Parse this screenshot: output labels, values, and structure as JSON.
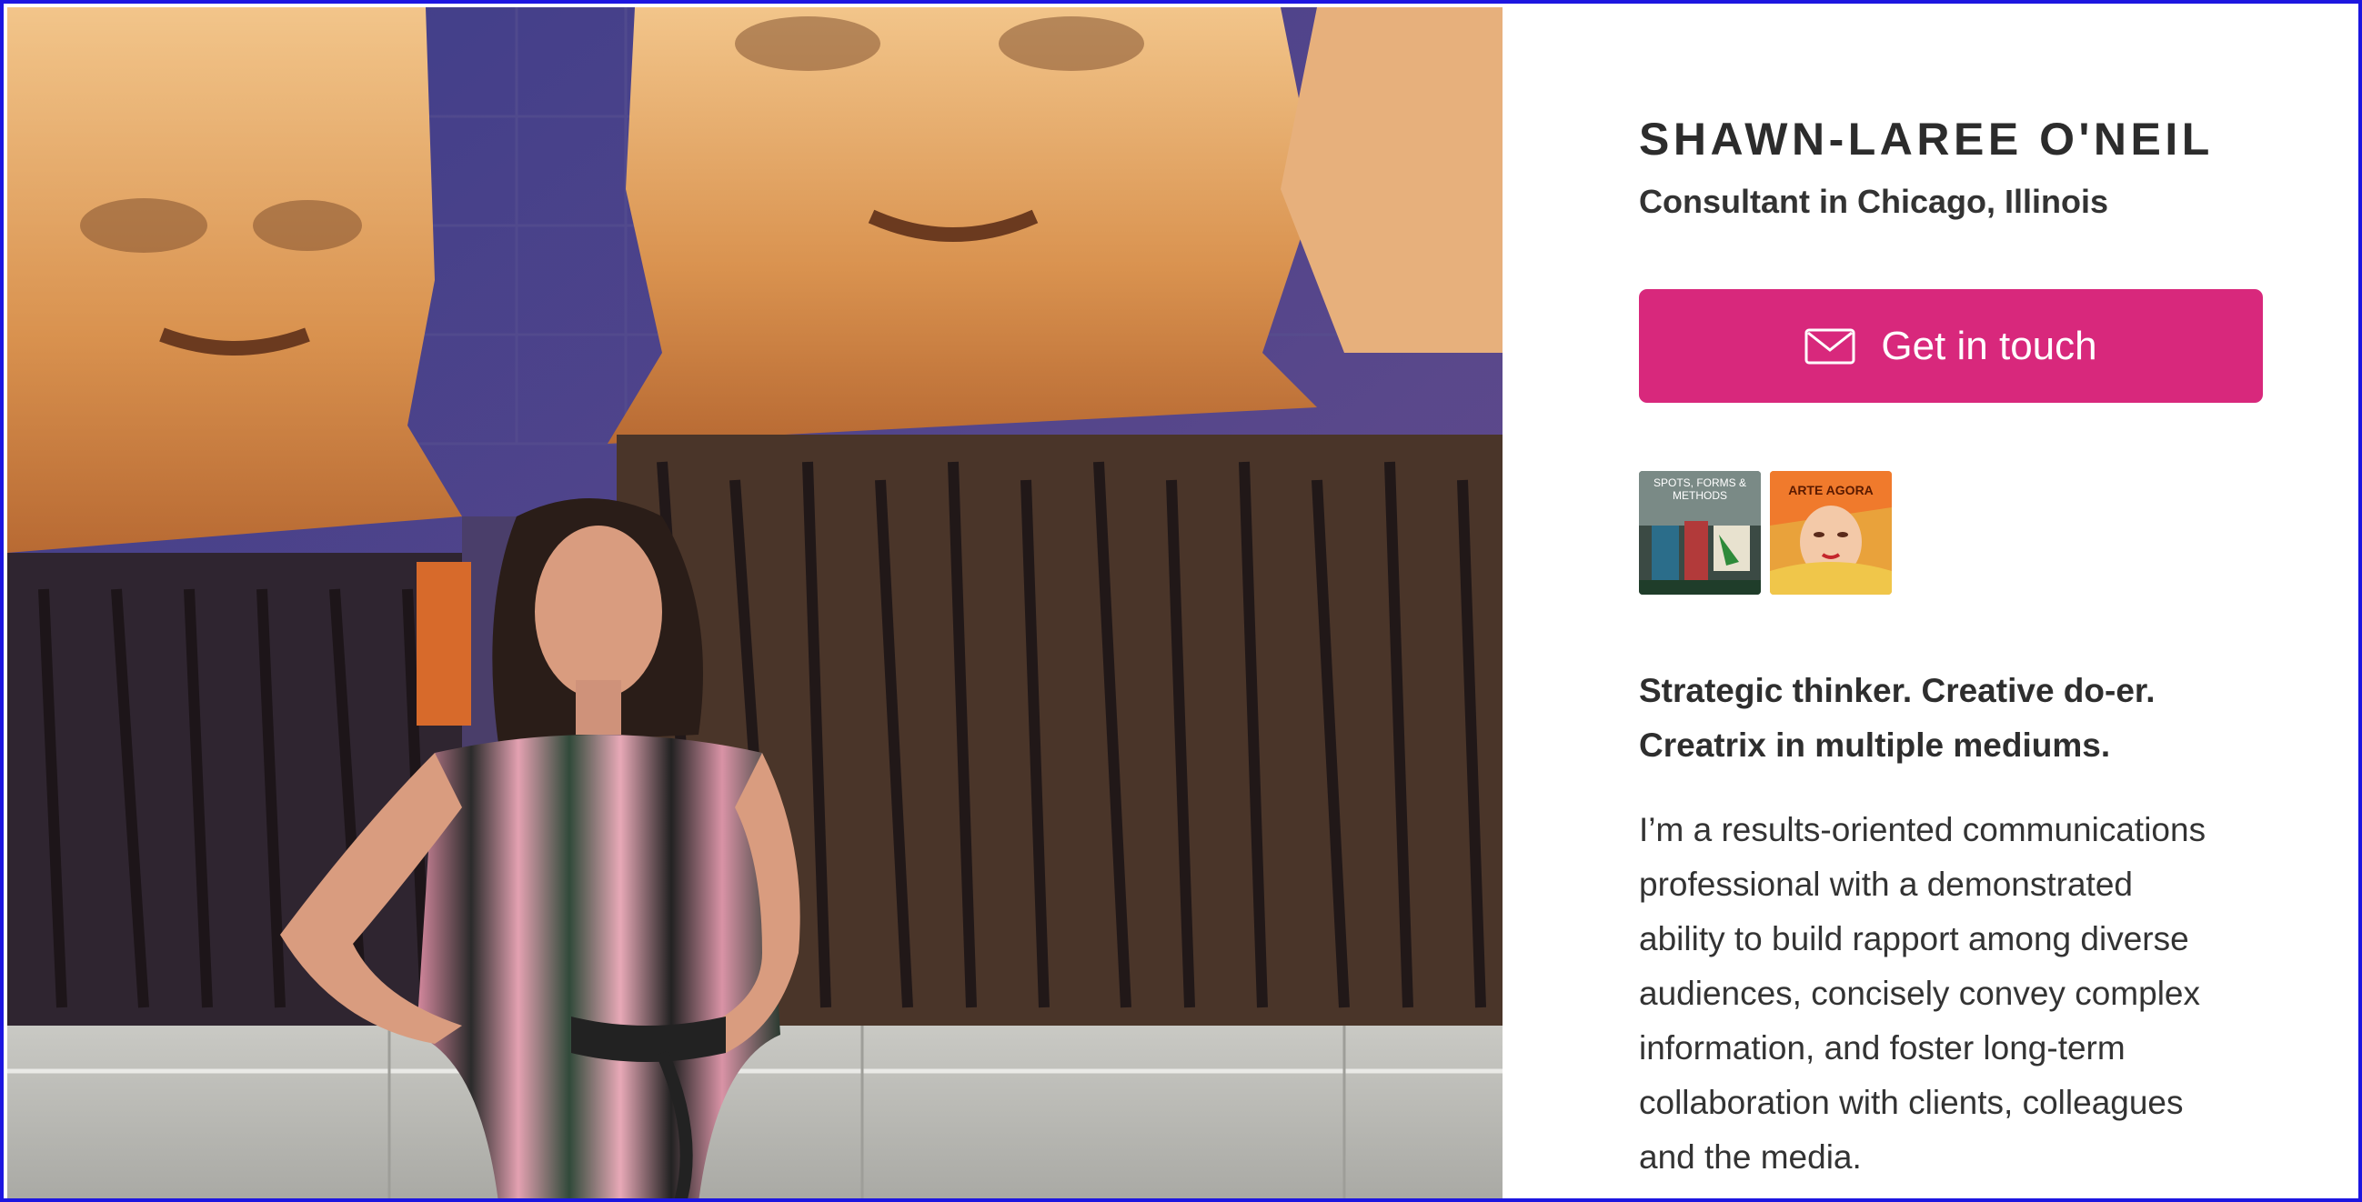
{
  "profile": {
    "name": "SHAWN-LAREE O'NEIL",
    "subtitle": "Consultant in Chicago, Illinois",
    "cta_label": "Get in touch",
    "cta_icon": "envelope-icon",
    "accent_color": "#d8287c",
    "border_color": "#1d16e0"
  },
  "gallery": [
    {
      "caption": "SPOTS, FORMS & METHODS"
    },
    {
      "caption": "ARTE AGORA"
    }
  ],
  "tagline_lines": [
    "Strategic thinker. Creative do-er.",
    "Creatrix in multiple mediums."
  ],
  "bio_lines": [
    "I’m a results-oriented communications",
    "professional with a demonstrated",
    "ability to build rapport among diverse",
    "audiences, concisely convey complex",
    "information, and foster long-term",
    "collaboration with clients, colleagues",
    "and the media."
  ]
}
